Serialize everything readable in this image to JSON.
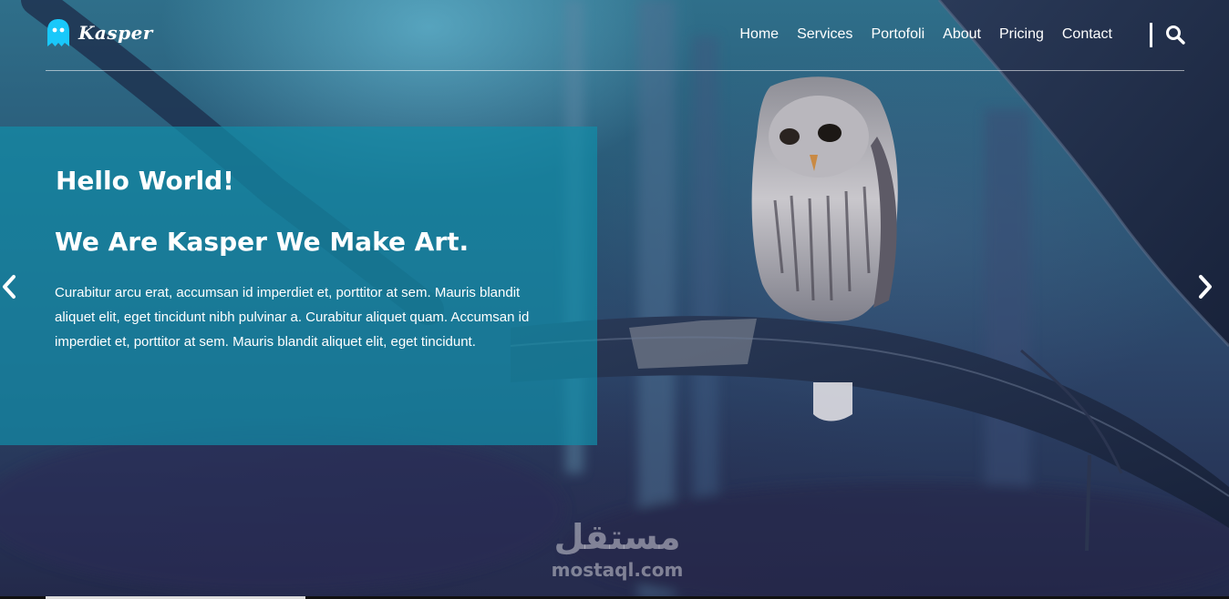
{
  "brand": {
    "name": "Kasper",
    "accent_color": "#19c8fa",
    "icon": "ghost-icon"
  },
  "nav": {
    "items": [
      {
        "label": "Home"
      },
      {
        "label": "Services"
      },
      {
        "label": "Portofoli"
      },
      {
        "label": "About"
      },
      {
        "label": "Pricing"
      },
      {
        "label": "Contact"
      }
    ],
    "search_icon": "search-icon"
  },
  "hero": {
    "greeting": "Hello World!",
    "tagline": "We Are Kasper We Make Art.",
    "description": "Curabitur arcu erat, accumsan id imperdiet et, porttitor at sem. Mauris blandit aliquet elit, eget tincidunt nibh pulvinar a. Curabitur aliquet quam. Accumsan id imperdiet et, porttitor at sem. Mauris blandit aliquet elit, eget tincidunt.",
    "panel_color": "#128ca8",
    "prev_icon": "chevron-left-icon",
    "next_icon": "chevron-right-icon"
  },
  "watermark": {
    "arabic": "مستقل",
    "latin": "mostaql.com"
  }
}
